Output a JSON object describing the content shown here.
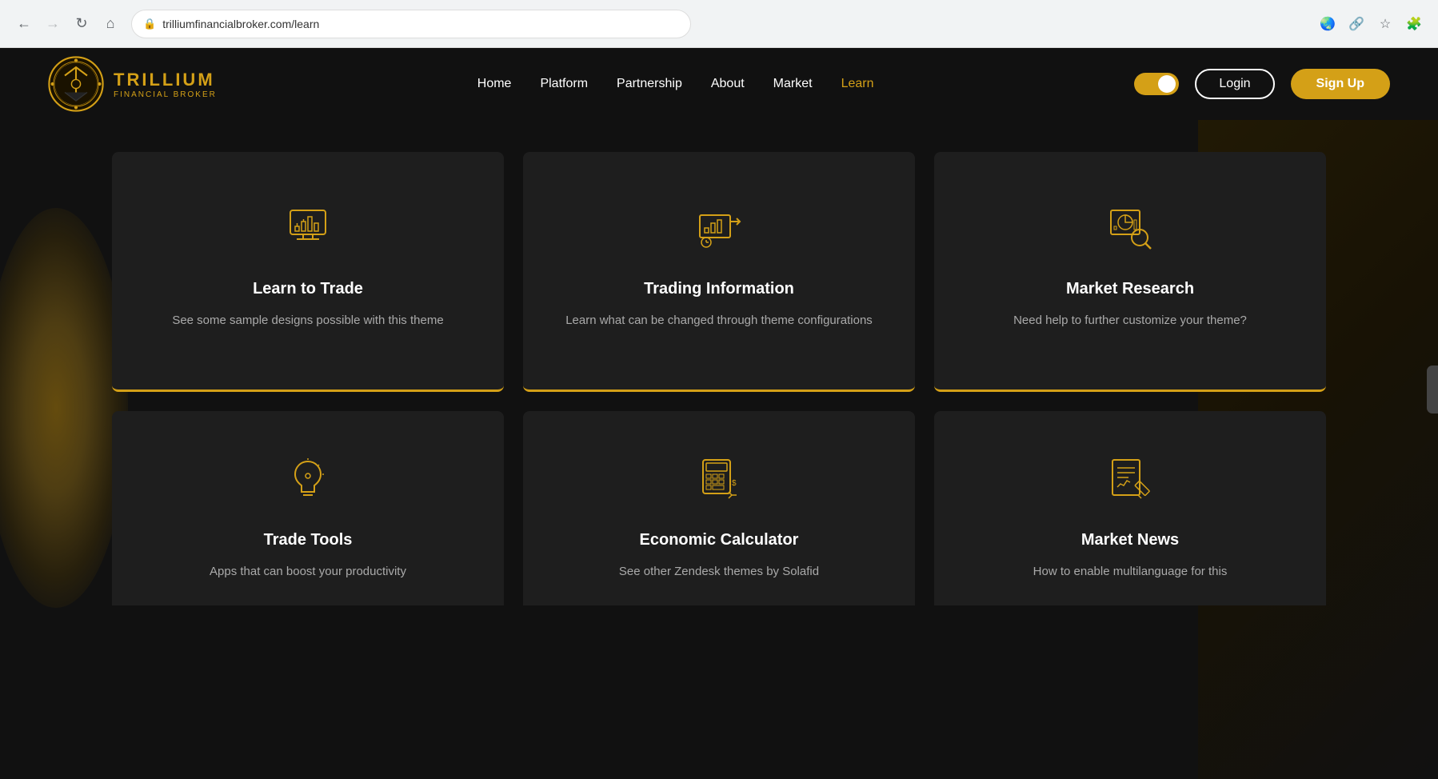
{
  "browser": {
    "url": "trilliumfinancialbroker.com/learn",
    "back_disabled": false,
    "forward_disabled": true
  },
  "navbar": {
    "logo_name": "TRILLIUM",
    "logo_sub": "FINANCIAL BROKER",
    "links": [
      {
        "id": "home",
        "label": "Home",
        "active": false
      },
      {
        "id": "platform",
        "label": "Platform",
        "active": false
      },
      {
        "id": "partnership",
        "label": "Partnership",
        "active": false
      },
      {
        "id": "about",
        "label": "About",
        "active": false
      },
      {
        "id": "market",
        "label": "Market",
        "active": false
      },
      {
        "id": "learn",
        "label": "Learn",
        "active": true
      }
    ],
    "login_label": "Login",
    "signup_label": "Sign Up"
  },
  "cards_row1": [
    {
      "id": "learn-to-trade",
      "icon": "chart-monitor",
      "title": "Learn to Trade",
      "description": "See some sample designs possible with this theme"
    },
    {
      "id": "trading-information",
      "icon": "chart-arrow",
      "title": "Trading Information",
      "description": "Learn what can be changed through theme configurations"
    },
    {
      "id": "market-research",
      "icon": "chart-magnify",
      "title": "Market Research",
      "description": "Need help to further customize your theme?"
    }
  ],
  "cards_row2": [
    {
      "id": "trade-tools",
      "icon": "lightbulb",
      "title": "Trade Tools",
      "description": "Apps that can boost your productivity"
    },
    {
      "id": "economic-calculator",
      "icon": "calculator",
      "title": "Economic Calculator",
      "description": "See other Zendesk themes by Solafid"
    },
    {
      "id": "market-news",
      "icon": "newspaper",
      "title": "Market News",
      "description": "How to enable multilanguage for this"
    }
  ],
  "colors": {
    "gold": "#d4a017",
    "dark_bg": "#111111",
    "card_bg": "#1e1e1e"
  }
}
